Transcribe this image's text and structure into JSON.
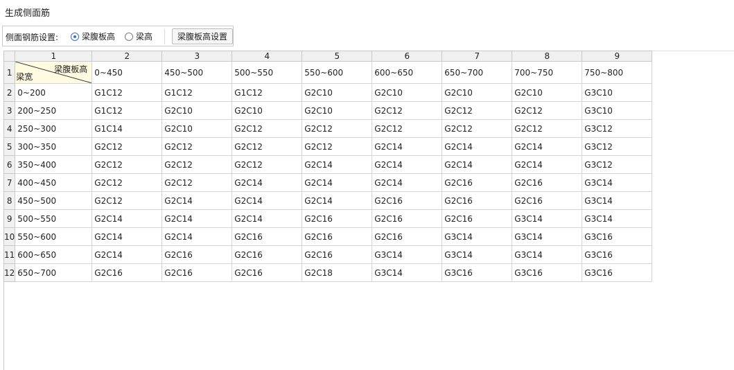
{
  "window": {
    "title": "生成侧面筋"
  },
  "toolbar": {
    "label": "侧面钢筋设置:",
    "radio_options": [
      {
        "label": "梁腹板高",
        "checked": true
      },
      {
        "label": "梁高",
        "checked": false
      }
    ],
    "settings_button": "梁腹板高设置"
  },
  "grid": {
    "column_headers": [
      "1",
      "2",
      "3",
      "4",
      "5",
      "6",
      "7",
      "8",
      "9"
    ],
    "row_headers": [
      "1",
      "2",
      "3",
      "4",
      "5",
      "6",
      "7",
      "8",
      "9",
      "10",
      "11",
      "12"
    ],
    "corner": {
      "top_label": "梁腹板高",
      "bottom_label": "梁宽"
    },
    "header_row": [
      "0~450",
      "450~500",
      "500~550",
      "550~600",
      "600~650",
      "650~700",
      "700~750",
      "750~800"
    ],
    "rows": [
      {
        "width": "0~200",
        "cells": [
          "G1C12",
          "G1C12",
          "G1C12",
          "G2C10",
          "G2C10",
          "G2C10",
          "G2C10",
          "G3C10"
        ]
      },
      {
        "width": "200~250",
        "cells": [
          "G1C12",
          "G2C10",
          "G2C10",
          "G2C10",
          "G2C12",
          "G2C12",
          "G2C12",
          "G3C10"
        ]
      },
      {
        "width": "250~300",
        "cells": [
          "G1C14",
          "G2C10",
          "G2C12",
          "G2C12",
          "G2C12",
          "G2C12",
          "G2C12",
          "G3C12"
        ]
      },
      {
        "width": "300~350",
        "cells": [
          "G2C12",
          "G2C12",
          "G2C12",
          "G2C12",
          "G2C14",
          "G2C14",
          "G2C14",
          "G3C12"
        ]
      },
      {
        "width": "350~400",
        "cells": [
          "G2C12",
          "G2C12",
          "G2C12",
          "G2C14",
          "G2C14",
          "G2C14",
          "G2C14",
          "G3C12"
        ]
      },
      {
        "width": "400~450",
        "cells": [
          "G2C12",
          "G2C12",
          "G2C14",
          "G2C14",
          "G2C14",
          "G2C16",
          "G2C16",
          "G3C14"
        ]
      },
      {
        "width": "450~500",
        "cells": [
          "G2C12",
          "G2C14",
          "G2C14",
          "G2C14",
          "G2C16",
          "G2C16",
          "G2C16",
          "G3C14"
        ]
      },
      {
        "width": "500~550",
        "cells": [
          "G2C14",
          "G2C14",
          "G2C14",
          "G2C16",
          "G2C16",
          "G2C16",
          "G3C14",
          "G3C14"
        ]
      },
      {
        "width": "550~600",
        "cells": [
          "G2C14",
          "G2C14",
          "G2C16",
          "G2C16",
          "G2C16",
          "G3C14",
          "G3C14",
          "G3C16"
        ]
      },
      {
        "width": "600~650",
        "cells": [
          "G2C14",
          "G2C16",
          "G2C16",
          "G2C16",
          "G3C14",
          "G3C14",
          "G3C14",
          "G3C16"
        ]
      },
      {
        "width": "650~700",
        "cells": [
          "G2C16",
          "G2C16",
          "G2C16",
          "G2C18",
          "G3C14",
          "G3C16",
          "G3C16",
          "G3C16"
        ]
      }
    ]
  },
  "colors": {
    "header_bg": "#f0f0f0",
    "corner_bg": "#fffbe0",
    "accent": "#3b6fd6"
  }
}
